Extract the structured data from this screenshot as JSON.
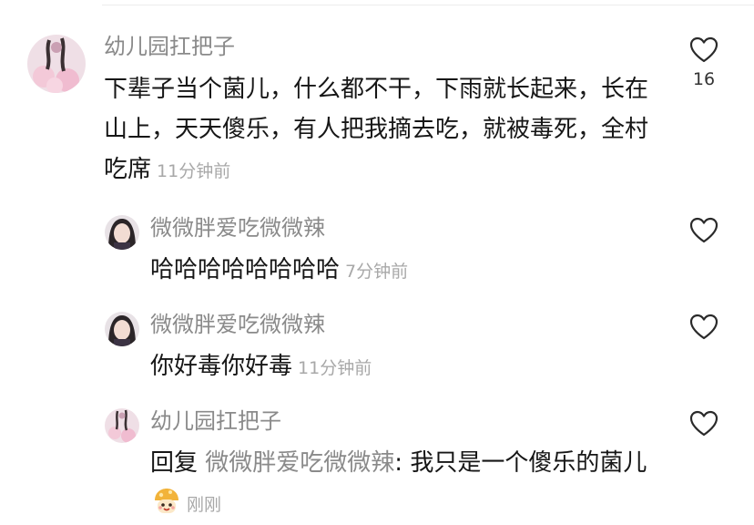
{
  "comments": [
    {
      "username": "幼儿园扛把子",
      "text": "下辈子当个菌儿，什么都不干，下雨就长起来，长在山上，天天傻乐，有人把我摘去吃，就被毒死，全村吃席",
      "time": "11分钟前",
      "likes": "16",
      "avatar_icon": "pink-floral-avatar"
    }
  ],
  "replies": [
    {
      "username": "微微胖爱吃微微辣",
      "text": "哈哈哈哈哈哈哈哈",
      "time": "7分钟前",
      "avatar_icon": "girl-portrait-avatar"
    },
    {
      "username": "微微胖爱吃微微辣",
      "text": "你好毒你好毒",
      "time": "11分钟前",
      "avatar_icon": "girl-portrait-avatar"
    },
    {
      "username": "幼儿园扛把子",
      "reply_prefix": "回复",
      "mention": "微微胖爱吃微微辣",
      "text": ": 我只是一个傻乐的菌儿",
      "time": "刚刚",
      "emoji_icon": "mushroom-emoji",
      "avatar_icon": "pink-floral-avatar"
    }
  ],
  "colors": {
    "username": "#8a8a8a",
    "timestamp": "#a8a8a8",
    "text": "#161616",
    "heart_outline": "#2a2a2a"
  }
}
